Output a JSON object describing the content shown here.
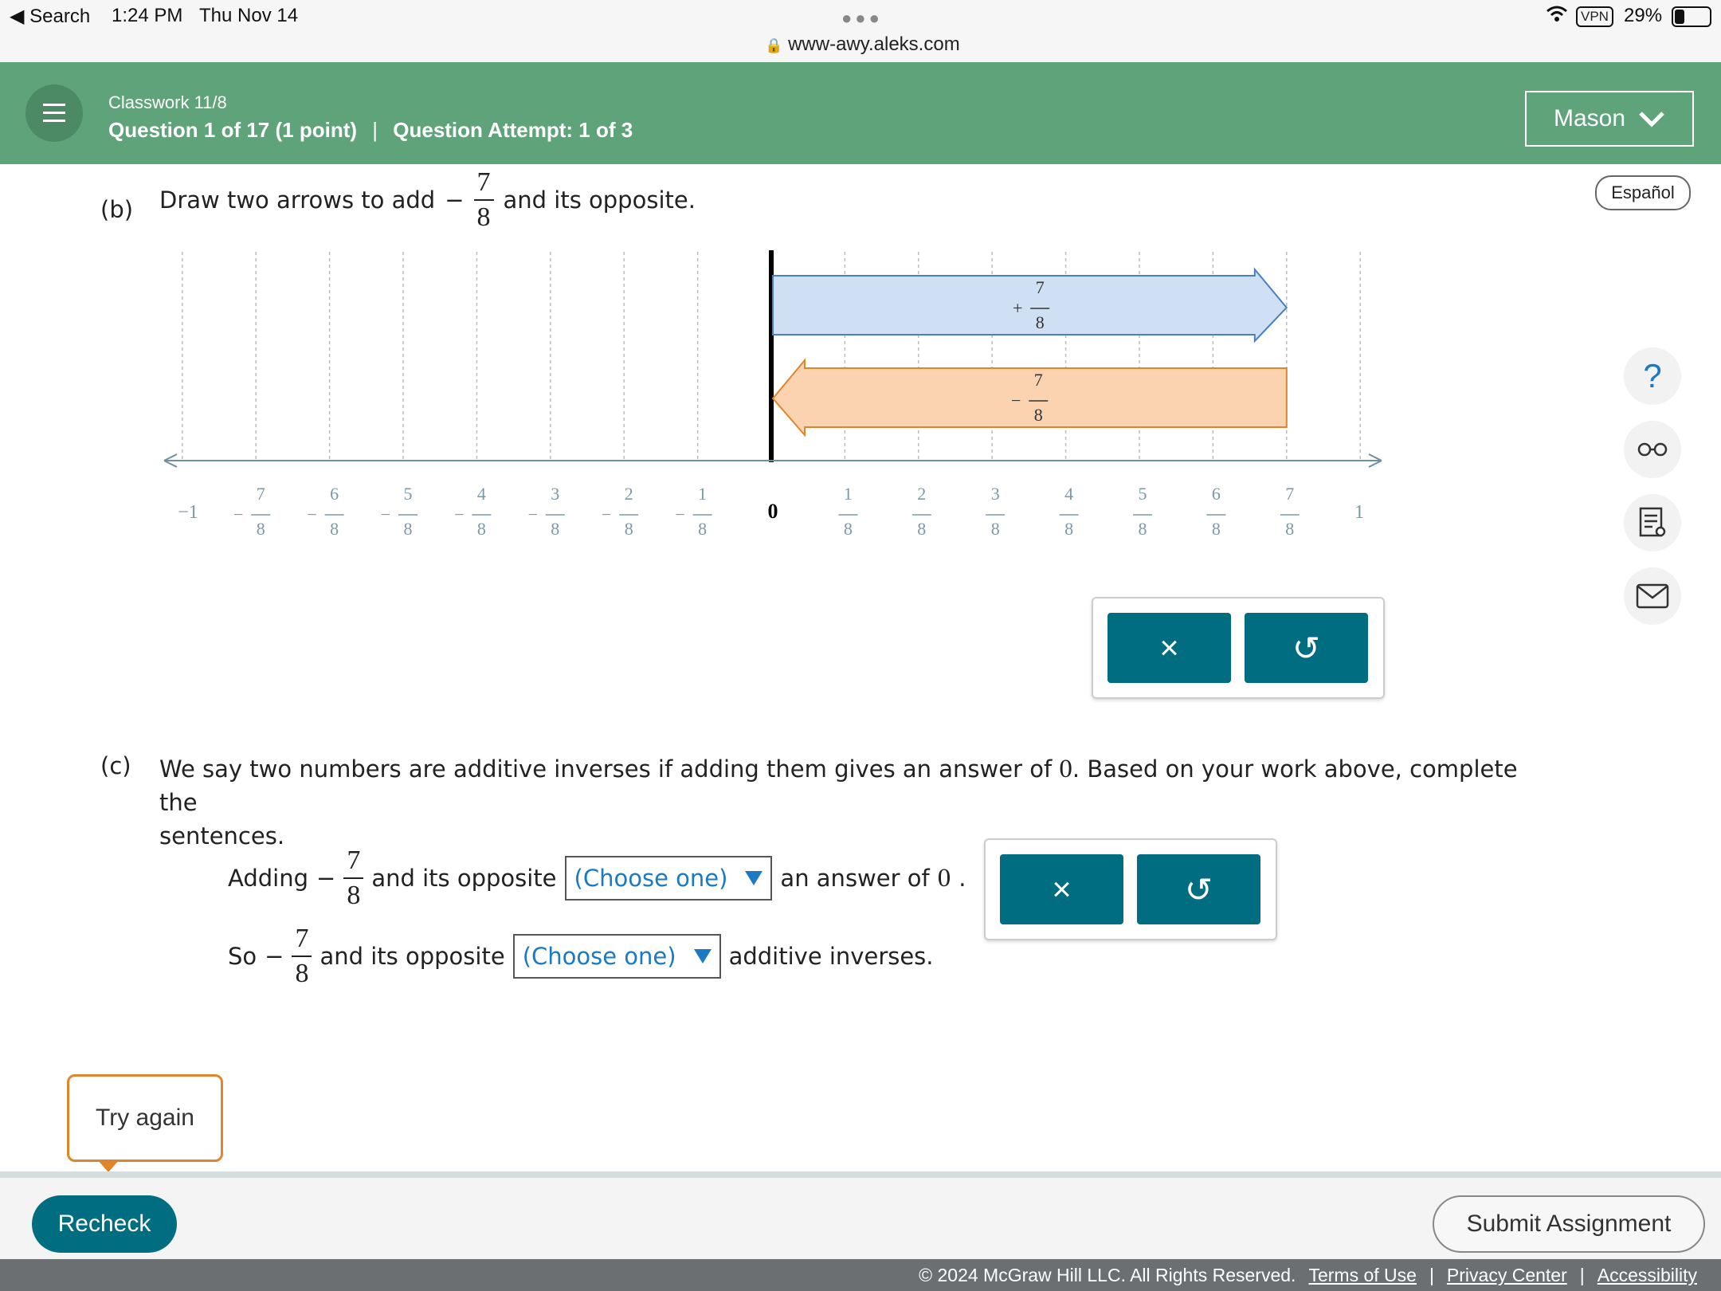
{
  "status_bar": {
    "back": "◀ Search",
    "time": "1:24 PM",
    "date": "Thu Nov 14",
    "url": "www-awy.aleks.com",
    "vpn": "VPN",
    "battery": "29%"
  },
  "header": {
    "classwork": "Classwork 11/8",
    "question": "Question 1 of 17 (1 point)",
    "separator": "|",
    "attempt": "Question Attempt: 1 of 3",
    "user": "Mason"
  },
  "espanol": "Español",
  "part_b": {
    "label": "(b)",
    "text_before": "Draw two arrows to add",
    "neg_sign": "−",
    "num": "7",
    "den": "8",
    "text_after": "and its opposite."
  },
  "number_line": {
    "zero_label": "0",
    "left_end": "−1",
    "right_end": "1",
    "neg_ticks": [
      {
        "sign": "−",
        "num": "7",
        "den": "8"
      },
      {
        "sign": "−",
        "num": "6",
        "den": "8"
      },
      {
        "sign": "−",
        "num": "5",
        "den": "8"
      },
      {
        "sign": "−",
        "num": "4",
        "den": "8"
      },
      {
        "sign": "−",
        "num": "3",
        "den": "8"
      },
      {
        "sign": "−",
        "num": "2",
        "den": "8"
      },
      {
        "sign": "−",
        "num": "1",
        "den": "8"
      }
    ],
    "pos_ticks": [
      {
        "num": "1",
        "den": "8"
      },
      {
        "num": "2",
        "den": "8"
      },
      {
        "num": "3",
        "den": "8"
      },
      {
        "num": "4",
        "den": "8"
      },
      {
        "num": "5",
        "den": "8"
      },
      {
        "num": "6",
        "den": "8"
      },
      {
        "num": "7",
        "den": "8"
      }
    ],
    "arrow_pos": {
      "sign": "+",
      "num": "7",
      "den": "8",
      "from": 0,
      "to": 0.875,
      "color": "#cfe0f5",
      "stroke": "#4a7fc0"
    },
    "arrow_neg": {
      "sign": "−",
      "num": "7",
      "den": "8",
      "from": 0.875,
      "to": 0,
      "color": "#fcd3b0",
      "stroke": "#e0852a"
    }
  },
  "part_c": {
    "label": "(c)",
    "intro_1": "We say two numbers are additive inverses if adding them gives an answer of",
    "zero": "0",
    "intro_2": ". Based on your work above, complete the",
    "intro_3": "sentences.",
    "s1_start": "Adding",
    "s1_mid": "and its opposite",
    "s1_end": "an answer of",
    "s1_end_zero": "0",
    "s1_period": ".",
    "s2_start": "So",
    "s2_mid": "and its opposite",
    "s2_end": "additive inverses.",
    "neg_sign": "−",
    "num": "7",
    "den": "8",
    "dropdown_placeholder": "(Choose one)"
  },
  "tools": {
    "clear_symbol": "×",
    "undo_symbol": "↺"
  },
  "feedback": "Try again",
  "recheck": "Recheck",
  "submit": "Submit Assignment",
  "copyright": "© 2024 McGraw Hill LLC. All Rights Reserved.",
  "links": [
    "Terms of Use",
    "Privacy Center",
    "Accessibility"
  ],
  "link_sep": "|",
  "colors": {
    "header": "#5fa37b",
    "button": "#006d80",
    "accent_orange": "#e0852a",
    "link_blue": "#1a7ac4"
  }
}
